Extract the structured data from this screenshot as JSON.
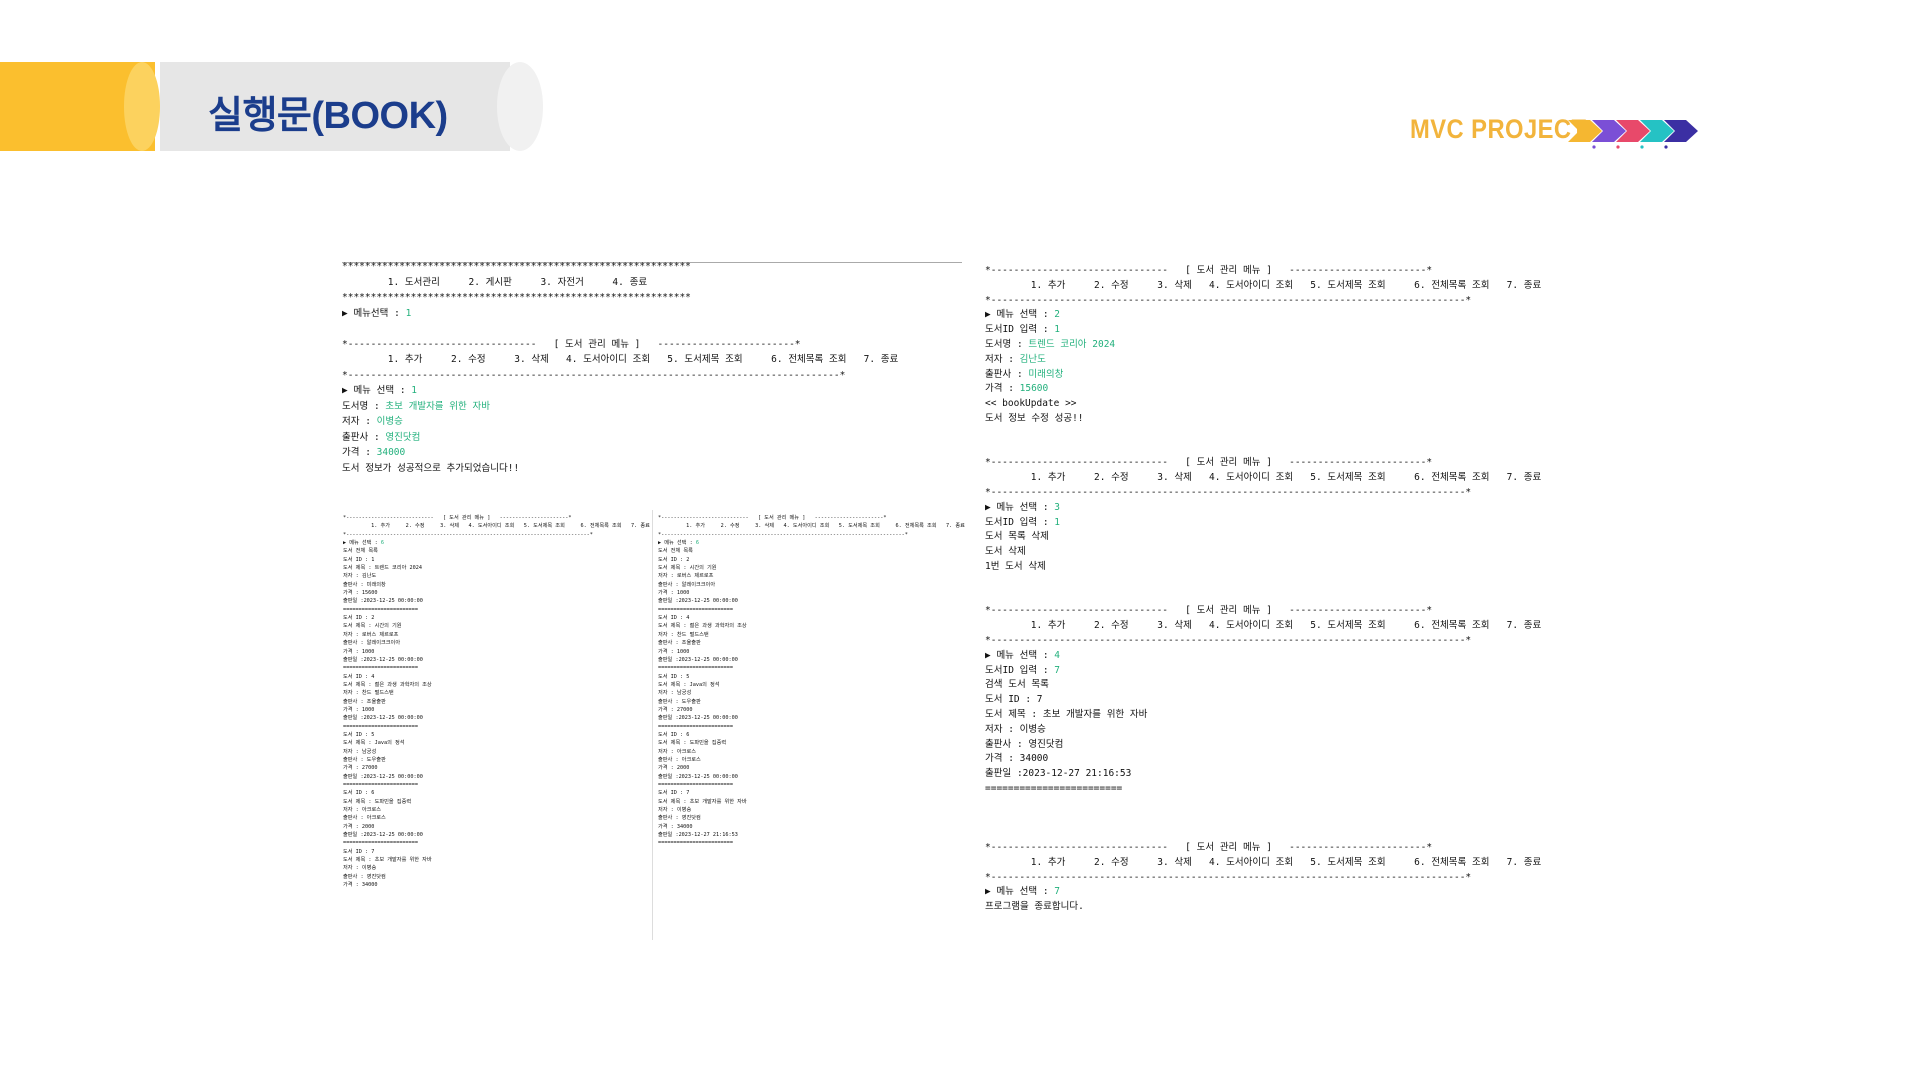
{
  "header": {
    "title": "실행문(BOOK)",
    "project_label": "MVC PROJECT",
    "arrow_colors": [
      "#f5b731",
      "#7b4fd6",
      "#e8496a",
      "#25c2c4",
      "#3b2fa3"
    ]
  },
  "panel_left": [
    "*************************************************************",
    "        1. 도서관리     2. 게시판     3. 자전거     4. 종료",
    "*************************************************************",
    "▶ 메뉴선택 : |1",
    "",
    "*---------------------------------   [ 도서 관리 메뉴 ]   ------------------------*",
    "        1. 추가     2. 수정     3. 삭제   4. 도서아이디 조회   5. 도서제목 조회     6. 전체목록 조회   7. 종료",
    "*--------------------------------------------------------------------------------------*",
    "▶ 메뉴 선택 : |1",
    "도서명 : |초보 개발자를 위한 자바",
    "저자 : |이병승",
    "출판사 : |영진닷컴",
    "가격 : |34000",
    "도서 정보가 성공적으로 추가되었습니다!!"
  ],
  "panel_right": [
    "*-------------------------------   [ 도서 관리 메뉴 ]   ------------------------*",
    "        1. 추가     2. 수정     3. 삭제   4. 도서아이디 조회   5. 도서제목 조회     6. 전체목록 조회   7. 종료",
    "*-----------------------------------------------------------------------------------*",
    "▶ 메뉴 선택 : |2",
    "도서ID 입력 : |1",
    "도서명 : |트렌드 코리아 2024",
    "저자 : |김난도",
    "출판사 : |미래의창",
    "가격 : |15600",
    "<< bookUpdate >>",
    "도서 정보 수정 성공!!",
    "",
    "",
    "*-------------------------------   [ 도서 관리 메뉴 ]   ------------------------*",
    "        1. 추가     2. 수정     3. 삭제   4. 도서아이디 조회   5. 도서제목 조회     6. 전체목록 조회   7. 종료",
    "*-----------------------------------------------------------------------------------*",
    "▶ 메뉴 선택 : |3",
    "도서ID 입력 : |1",
    "도서 목록 삭제",
    "도서 삭제",
    "1번 도서 삭제",
    "",
    "",
    "*-------------------------------   [ 도서 관리 메뉴 ]   ------------------------*",
    "        1. 추가     2. 수정     3. 삭제   4. 도서아이디 조회   5. 도서제목 조회     6. 전체목록 조회   7. 종료",
    "*-----------------------------------------------------------------------------------*",
    "▶ 메뉴 선택 : |4",
    "도서ID 입력 : |7",
    "검색 도서 목록",
    "도서 ID : 7",
    "도서 제목 : 초보 개발자를 위한 자바",
    "저자 : 이병승",
    "출판사 : 영진닷컴",
    "가격 : 34000",
    "출판일 :2023-12-27 21:16:53",
    "========================",
    "",
    "",
    "",
    "*-------------------------------   [ 도서 관리 메뉴 ]   ------------------------*",
    "        1. 추가     2. 수정     3. 삭제   4. 도서아이디 조회   5. 도서제목 조회     6. 전체목록 조회   7. 종료",
    "*-----------------------------------------------------------------------------------*",
    "▶ 메뉴 선택 : |7",
    "프로그램을 종료합니다."
  ],
  "mini_left": [
    "*----------------------------   [ 도서 관리 메뉴 ]   ----------------------*",
    "         1. 추가     2. 수정     3. 삭제   4. 도서아이디 조회   5. 도서제목 조회     6. 전체목록 조회   7. 종료",
    "*------------------------------------------------------------------------------*",
    "▶ 메뉴 선택 : |6",
    "도서 전체 목록",
    "도서 ID : 1",
    "도서 제목 : 트렌드 코리아 2024",
    "저자 : 김난도",
    "출판사 : 미래의창",
    "가격 : 15600",
    "출판일 :2023-12-25 00:00:00",
    "========================",
    "도서 ID : 2",
    "도서 제목 : 시간의 기원",
    "저자 : 로버스 제르로프",
    "출판사 : 알레이크크이아",
    "가격 : 1000",
    "출판일 :2023-12-25 00:00:00",
    "========================",
    "도서 ID : 4",
    "도서 제목 : 젊은 과생 과학자의 조상",
    "저자 : 찬드 펄드스탠",
    "출판사 : 조율출판",
    "가격 : 1000",
    "출판일 :2023-12-25 00:00:00",
    "========================",
    "도서 ID : 5",
    "도서 제목 : Java의 정석",
    "저자 : 남궁성",
    "출판사 : 도우출판",
    "가격 : 27000",
    "출판일 :2023-12-25 00:00:00",
    "========================",
    "도서 ID : 6",
    "도서 제목 : 도파민을 집중력",
    "저자 : 아크로스",
    "출판사 : 아크로스",
    "가격 : 2000",
    "출판일 :2023-12-25 00:00:00",
    "========================",
    "도서 ID : 7",
    "도서 제목 : 초보 개발자를 위한 자바",
    "저자 : 이병승",
    "출판사 : 영진닷컴",
    "가격 : 34000"
  ],
  "mini_right": [
    "*----------------------------   [ 도서 관리 메뉴 ]   ----------------------*",
    "         1. 추가     2. 수정     3. 삭제   4. 도서아이디 조회   5. 도서제목 조회     6. 전체목록 조회   7. 종료",
    "*------------------------------------------------------------------------------*",
    "▶ 메뉴 선택 : |6",
    "도서 전체 목록",
    "도서 ID : 2",
    "도서 제목 : 시간의 기원",
    "저자 : 로버스 제르로프",
    "출판사 : 알레이크크이아",
    "가격 : 1000",
    "출판일 :2023-12-25 00:00:00",
    "========================",
    "도서 ID : 4",
    "도서 제목 : 젊은 과생 과학자의 조상",
    "저자 : 찬드 펄드스탠",
    "출판사 : 조율출판",
    "가격 : 1000",
    "출판일 :2023-12-25 00:00:00",
    "========================",
    "도서 ID : 5",
    "도서 제목 : Java의 정석",
    "저자 : 남궁성",
    "출판사 : 도우출판",
    "가격 : 27000",
    "출판일 :2023-12-25 00:00:00",
    "========================",
    "도서 ID : 6",
    "도서 제목 : 도파민을 집중력",
    "저자 : 아크로스",
    "출판사 : 아크로스",
    "가격 : 2000",
    "출판일 :2023-12-25 00:00:00",
    "========================",
    "도서 ID : 7",
    "도서 제목 : 초보 개발자를 위한 자바",
    "저자 : 이병승",
    "출판사 : 영진닷컴",
    "가격 : 34000",
    "출판일 :2023-12-27 21:16:53",
    "========================"
  ]
}
